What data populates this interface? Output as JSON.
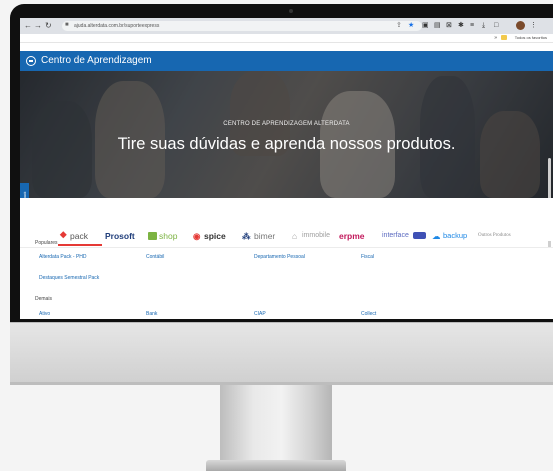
{
  "browser": {
    "url": "ajuda.alterdata.com.br/suporteexpress",
    "bookmark_folder_label": "Todos os favoritos",
    "nav_icons": [
      "back-icon",
      "forward-icon",
      "reload-icon"
    ]
  },
  "header": {
    "app_title": "Centro de Aprendizagem"
  },
  "hero": {
    "eyebrow": "CENTRO DE APRENDIZAGEM ALTERDATA",
    "title": "Tire suas dúvidas e aprenda nossos produtos."
  },
  "feedback_tab": {
    "label": "Enviar Feedback"
  },
  "products": [
    {
      "name": "pack",
      "color": "#e53935"
    },
    {
      "name": "Prosoft",
      "color": "#1f3d7a"
    },
    {
      "name": "shop",
      "color": "#7cb342"
    },
    {
      "name": "spice",
      "color": "#e53935"
    },
    {
      "name": "bimer",
      "color": "#1f3d7a"
    },
    {
      "name": "immobile",
      "color": "#9e9e9e"
    },
    {
      "name": "erpme",
      "color": "#c2185b"
    },
    {
      "name": "interface",
      "color": "#5c6bc0"
    },
    {
      "name": "backup",
      "color": "#1e88e5"
    },
    {
      "name": "Outros Produtos",
      "color": "#8a8a8a"
    }
  ],
  "sections": {
    "popular_heading": "Populares",
    "popular_links": [
      "Alterdata Pack - PHD",
      "Contábil",
      "Departamento Pessoal",
      "Fiscal",
      "Destaques Semestral Pack"
    ],
    "others_heading": "Demais",
    "other_links": [
      "Ativo",
      "Bank",
      "CIAP",
      "Collect"
    ]
  }
}
